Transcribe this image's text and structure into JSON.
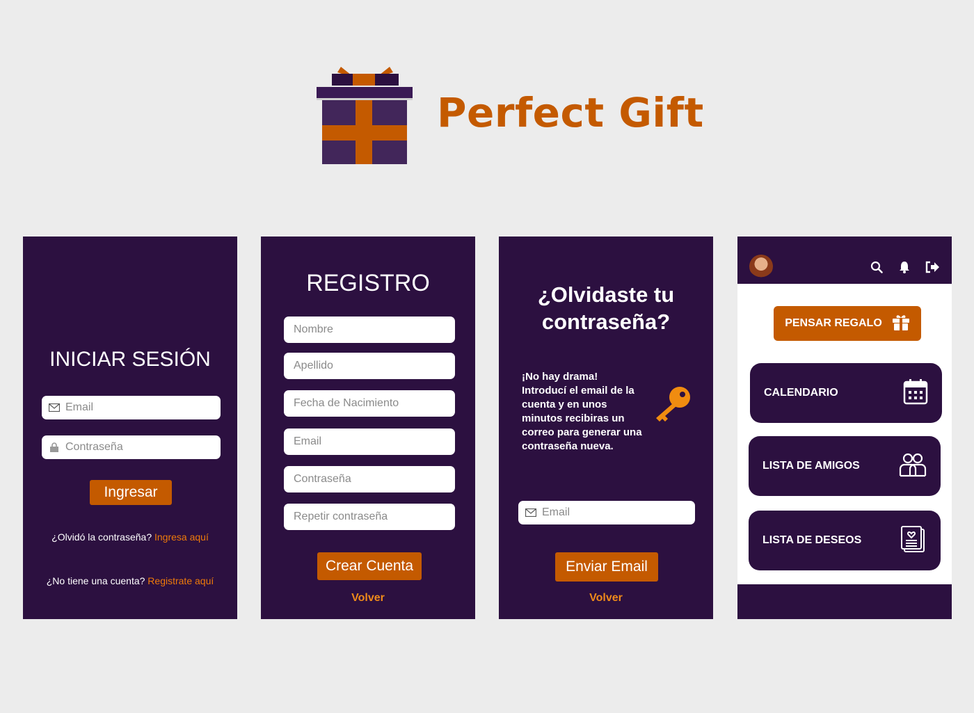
{
  "brand": {
    "name": "Perfect Gift",
    "logo_icon": "gift-box-icon"
  },
  "colors": {
    "primary_dark": "#2c1040",
    "accent": "#c45a00",
    "link": "#ee7a0a",
    "background": "#ececec"
  },
  "login": {
    "title": "INICIAR SESIÓN",
    "email_placeholder": "Email",
    "password_placeholder": "Contraseña",
    "submit": "Ingresar",
    "forgot_text": "¿Olvidó la contraseña?",
    "forgot_link": "Ingresa aquí",
    "signup_text": "¿No tiene una cuenta?",
    "signup_link": "Registrate aquí"
  },
  "register": {
    "title": "REGISTRO",
    "fields": [
      "Nombre",
      "Apellido",
      "Fecha de Nacimiento",
      "Email",
      "Contraseña",
      "Repetir contraseña"
    ],
    "submit": "Crear Cuenta",
    "back": "Volver"
  },
  "forgot": {
    "title_line1": "¿Olvidaste tu",
    "title_line2": "contraseña?",
    "message_lines": [
      "¡No hay drama!",
      "Introducí el email de la",
      "cuenta y en unos",
      "minutos recibiras un",
      "correo para generar una",
      "contraseña nueva."
    ],
    "email_placeholder": "Email",
    "submit": "Enviar Email",
    "back": "Volver"
  },
  "home": {
    "icons": [
      "search-icon",
      "bell-icon",
      "logout-icon"
    ],
    "think_gift": "PENSAR REGALO",
    "cards": [
      {
        "label": "CALENDARIO",
        "icon": "calendar-icon"
      },
      {
        "label": "LISTA DE AMIGOS",
        "icon": "friends-icon"
      },
      {
        "label": "LISTA DE DESEOS",
        "icon": "wishlist-icon"
      }
    ]
  }
}
